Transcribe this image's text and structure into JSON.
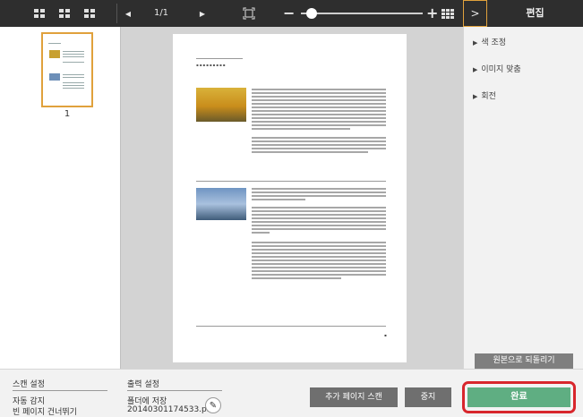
{
  "toolbar": {
    "page_indicator": "1/1",
    "zoom_minus": "−",
    "zoom_plus": "+",
    "zoom_level_fraction": 0.09
  },
  "edit_panel": {
    "toggle": ">",
    "title": "편집",
    "items": [
      {
        "label": "색 조정"
      },
      {
        "label": "이미지 맞춤"
      },
      {
        "label": "회전"
      }
    ],
    "revert_label": "원본으로 되돌리기"
  },
  "thumbnails": [
    {
      "number": "1"
    }
  ],
  "bottom": {
    "scan_settings": {
      "title": "스캔 설정",
      "line1": "자동 감지",
      "line2": "빈 페이지 건너뛰기"
    },
    "output_settings": {
      "title": "출력 설정",
      "line1": "폴더에 저장",
      "line2": "20140301174533.p..."
    },
    "add_scan_label": "추가 페이지 스캔",
    "stop_label": "중지",
    "done_label": "완료"
  },
  "colors": {
    "toolbar_bg": "#2e2e2e",
    "accent_orange": "#e0a13c",
    "done_green": "#5fae82",
    "highlight_red": "#d8262c",
    "button_gray": "#6f6f6f"
  }
}
